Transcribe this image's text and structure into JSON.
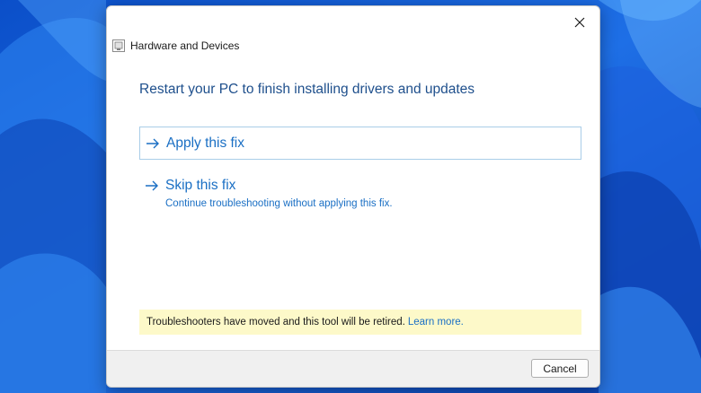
{
  "window": {
    "title": "Hardware and Devices",
    "app_icon": "troubleshooter-icon",
    "close_icon": "close-icon"
  },
  "heading": "Restart your PC to finish installing drivers and updates",
  "options": [
    {
      "title": "Apply this fix",
      "subtitle": "",
      "icon": "arrow-right-icon"
    },
    {
      "title": "Skip this fix",
      "subtitle": "Continue troubleshooting without applying this fix.",
      "icon": "arrow-right-icon"
    }
  ],
  "notice": {
    "text": "Troubleshooters have moved and this tool will be retired.",
    "link": "Learn more."
  },
  "footer": {
    "cancel_label": "Cancel"
  },
  "colors": {
    "heading": "#1e4f8c",
    "link": "#1a6fc4",
    "notice_bg": "#fdf9c9",
    "apply_border": "#a9cde8",
    "footer_bg": "#f0f0f0",
    "wallpaper": "#1f6fe0"
  }
}
